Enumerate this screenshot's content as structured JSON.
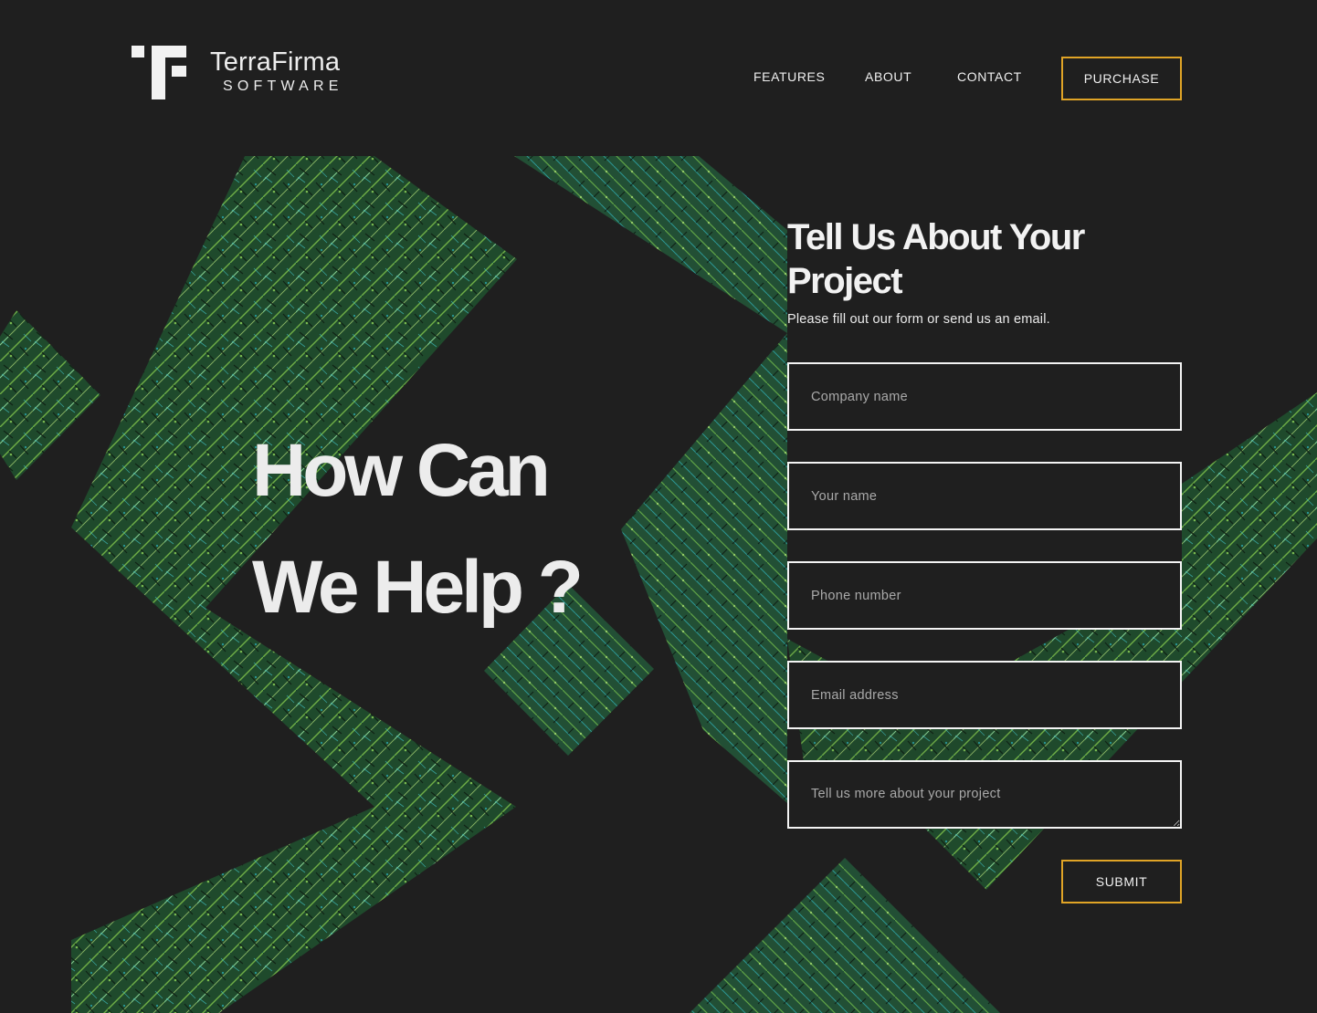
{
  "brand": {
    "name": "TerraFirma",
    "tagline": "SOFTWARE"
  },
  "nav": {
    "items": [
      {
        "label": "FEATURES"
      },
      {
        "label": "ABOUT"
      },
      {
        "label": "CONTACT"
      }
    ],
    "purchase_label": "PURCHASE"
  },
  "hero": {
    "line1": "How Can",
    "line2": "We Help ?"
  },
  "form": {
    "title": "Tell Us About Your Project",
    "subtitle": "Please fill out our form or send us an email.",
    "fields": {
      "company": {
        "placeholder": "Company name",
        "value": ""
      },
      "name": {
        "placeholder": "Your name",
        "value": ""
      },
      "phone": {
        "placeholder": "Phone number",
        "value": ""
      },
      "email": {
        "placeholder": "Email address",
        "value": ""
      },
      "project": {
        "placeholder": "Tell us more about your project",
        "value": ""
      }
    },
    "submit_label": "SUBMIT"
  },
  "colors": {
    "background": "#1f1f1f",
    "accent": "#e0a426",
    "text": "#f2f2f2",
    "terrain_green": "#4e8a2c",
    "terrain_teal": "#2aa6a8",
    "terrain_light": "#a8d66a"
  },
  "icons": {
    "logo_mark": "terrafirma-logo-icon",
    "textarea_resize": "resize-handle-icon"
  }
}
